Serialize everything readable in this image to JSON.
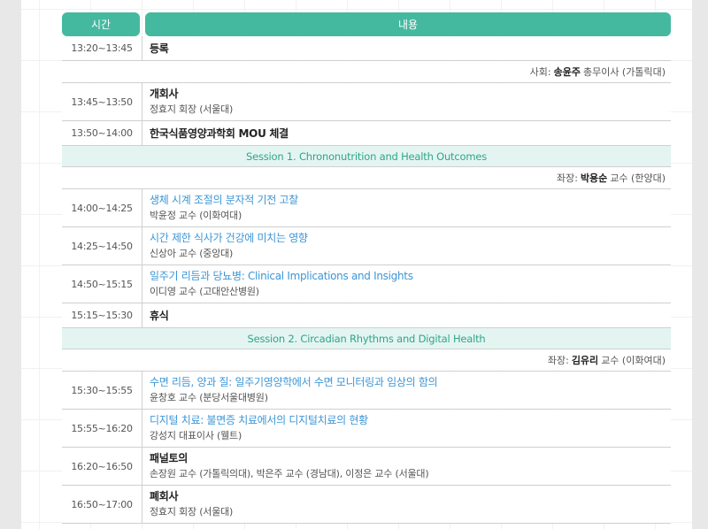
{
  "header": {
    "time": "시간",
    "content": "내용"
  },
  "rows": [
    {
      "kind": "item",
      "time": "13:20~13:45",
      "title": "등록",
      "speaker": "",
      "blue": false
    },
    {
      "kind": "chair",
      "label": "사회:",
      "name": "송윤주",
      "detail": "총무이사 (가톨릭대)"
    },
    {
      "kind": "item",
      "time": "13:45~13:50",
      "title": "개회사",
      "speaker": "정효지 회장 (서울대)",
      "blue": false
    },
    {
      "kind": "item",
      "time": "13:50~14:00",
      "title": "한국식품영양과학회 MOU 체결",
      "speaker": "",
      "blue": false
    },
    {
      "kind": "session",
      "label": "Session 1. Chrononutrition and Health Outcomes"
    },
    {
      "kind": "chair",
      "label": "좌장:",
      "name": "박용순",
      "detail": "교수 (한양대)"
    },
    {
      "kind": "item",
      "time": "14:00~14:25",
      "title": "생체 시계 조절의 분자적 기전 고찰",
      "speaker": "박윤정 교수 (이화여대)",
      "blue": true
    },
    {
      "kind": "item",
      "time": "14:25~14:50",
      "title": "시간 제한 식사가 건강에 미치는 영향",
      "speaker": "신상아 교수 (중앙대)",
      "blue": true
    },
    {
      "kind": "item",
      "time": "14:50~15:15",
      "title": "일주기 리듬과 당뇨병: Clinical Implications and Insights",
      "speaker": "이디영 교수 (고대안산병원)",
      "blue": true
    },
    {
      "kind": "item",
      "time": "15:15~15:30",
      "title": "휴식",
      "speaker": "",
      "blue": false
    },
    {
      "kind": "session",
      "label": "Session 2. Circadian Rhythms and Digital Health"
    },
    {
      "kind": "chair",
      "label": "좌장:",
      "name": "김유리",
      "detail": "교수 (이화여대)"
    },
    {
      "kind": "item",
      "time": "15:30~15:55",
      "title": "수면 리듬, 양과 질: 일주기영양학에서 수면 모니터링과 임상의 함의",
      "speaker": "윤창호 교수 (분당서울대병원)",
      "blue": true
    },
    {
      "kind": "item",
      "time": "15:55~16:20",
      "title": "디지털 치료: 불면증 치료에서의 디지털치료의 현황",
      "speaker": "강성지 대표이사 (웰트)",
      "blue": true
    },
    {
      "kind": "item",
      "time": "16:20~16:50",
      "title": "패널토의",
      "speaker": "손장원 교수 (가톨릭의대), 박은주 교수 (경남대), 이정은 교수 (서울대)",
      "blue": false
    },
    {
      "kind": "item",
      "time": "16:50~17:00",
      "title": "폐회사",
      "speaker": "정효지 회장 (서울대)",
      "blue": false
    }
  ]
}
